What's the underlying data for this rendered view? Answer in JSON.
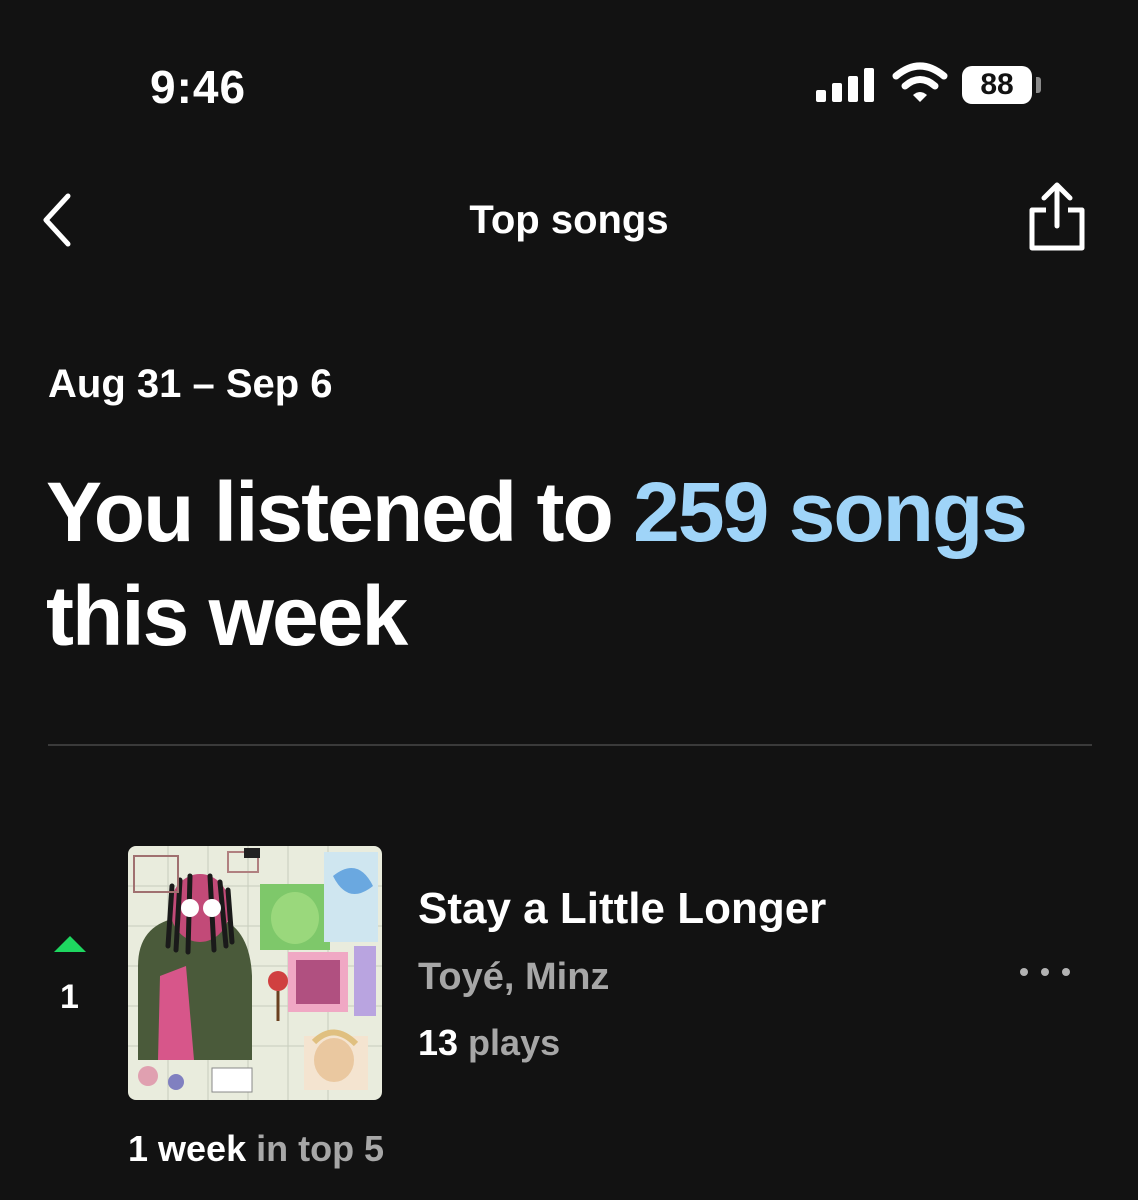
{
  "status_bar": {
    "time": "9:46",
    "battery": "88"
  },
  "nav": {
    "title": "Top songs",
    "back_icon": "chevron-left-icon",
    "share_icon": "share-icon"
  },
  "summary": {
    "date_range": "Aug 31 – Sep 6",
    "headline_prefix": "You listened to ",
    "headline_highlight": "259 songs",
    "headline_suffix": "this week",
    "highlight_color": "#9fd4f8"
  },
  "songs": [
    {
      "rank": "1",
      "trend": "up",
      "trend_color": "#1ed760",
      "title": "Stay a Little Longer",
      "artists": "Toyé, Minz",
      "plays_count": "13",
      "plays_label": " plays",
      "weeks_count": "1 week",
      "weeks_label": " in top 5"
    }
  ],
  "colors": {
    "background": "#121212",
    "text_secondary": "#a7a7a7"
  }
}
